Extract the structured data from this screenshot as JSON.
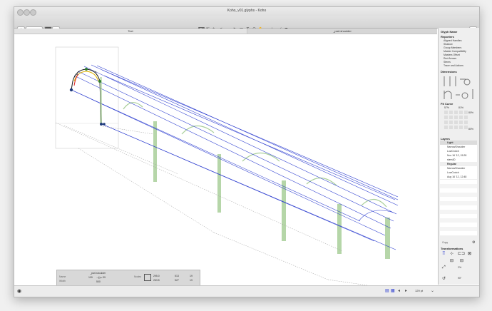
{
  "window": {
    "title": "Koho_v01.glyphs - Koho"
  },
  "tabs": [
    "Text",
    "_part.shoulder"
  ],
  "sidebar": {
    "glyph_name_header": "Glyph Name",
    "reporters_header": "Reporters",
    "reporters": [
      "Aligned Handles",
      "Shadow",
      "Group Members",
      "Master Compatibility",
      "Masters Offset",
      "Red Arrows",
      "Stems",
      "Trace and Actions"
    ],
    "dimensions_header": "Dimensions",
    "fit_curve_header": "Fit Curve",
    "fit_curve_min": "57%",
    "fit_curve_max": "81%",
    "fit_curve_right_top": "80%",
    "fit_curve_right_bottom": "80%",
    "layers_header": "Layers",
    "layer_groups": [
      {
        "name": "Light",
        "items": [
          "NarrowShoulder",
          "LowCrotch",
          "Nov 16 '12, 15:28",
          "stem30"
        ]
      },
      {
        "name": "Regular",
        "items": [
          "NarrowShoulder",
          "LowCrotch",
          "Aug 16 '12, 12:48"
        ]
      }
    ],
    "copy_label": "Copy",
    "transformations_header": "Transformations",
    "scale_value": "2%",
    "rotate_value": "90°",
    "slant_value": "5°"
  },
  "info": {
    "glyph_name": "_part.shoulder",
    "name_label": "Name",
    "width_label": "Width",
    "lsb": "109",
    "rsb": "39",
    "width": "500",
    "x_label": "Nodes",
    "x_value": "295.0",
    "y_value": "263.5",
    "w_value": "513",
    "h_value": "527",
    "bound_w": "19",
    "bound_h": "19"
  },
  "statusbar": {
    "zoom": "129 pt"
  },
  "colors": {
    "blue": "#2a3bcf",
    "green_fill": "#a9cf9a",
    "node_green": "#2f7f2f"
  }
}
